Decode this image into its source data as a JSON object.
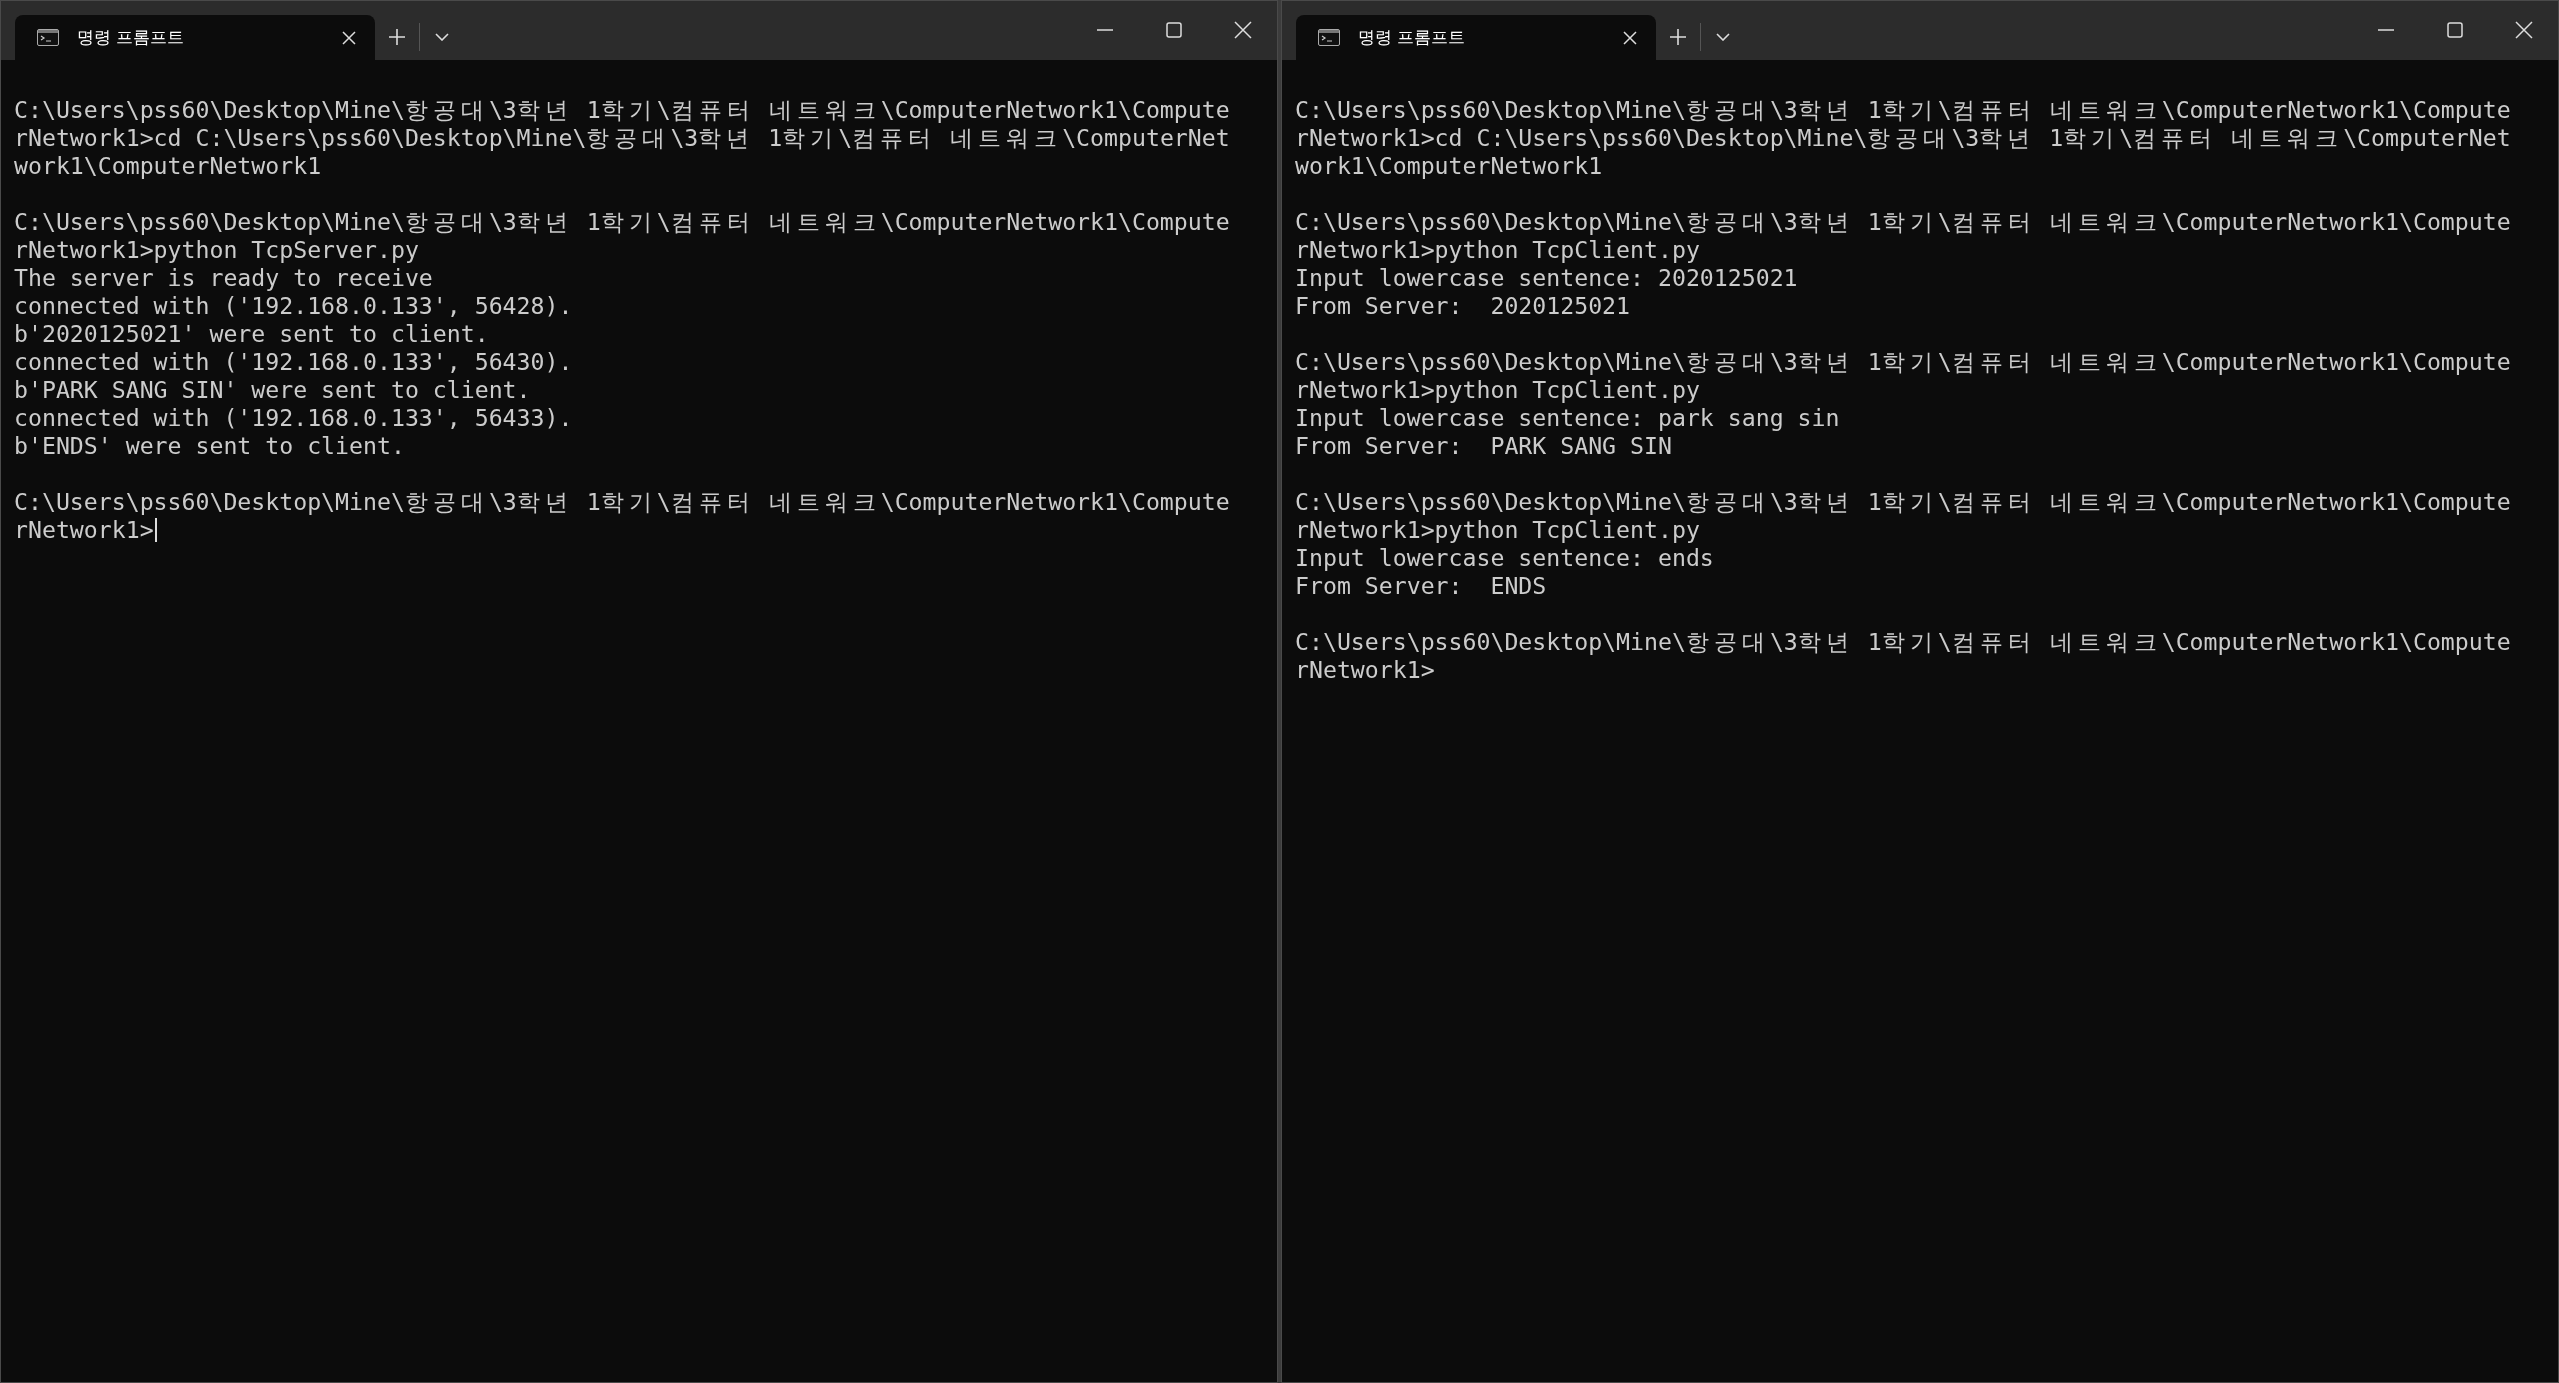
{
  "windows": [
    {
      "tab": {
        "title": "명령 프롬프트",
        "selected": true
      },
      "cursor": true,
      "blocks": [
        [
          "C:\\Users\\pss60\\Desktop\\Mine\\항공대\\3학년 1학기\\컴퓨터 네트워크\\ComputerNetwork1\\Compute",
          "rNetwork1>cd C:\\Users\\pss60\\Desktop\\Mine\\항공대\\3학년 1학기\\컴퓨터 네트워크\\ComputerNet",
          "work1\\ComputerNetwork1"
        ],
        [
          "C:\\Users\\pss60\\Desktop\\Mine\\항공대\\3학년 1학기\\컴퓨터 네트워크\\ComputerNetwork1\\Compute",
          "rNetwork1>python TcpServer.py",
          "The server is ready to receive",
          "connected with ('192.168.0.133', 56428).",
          "b'2020125021' were sent to client.",
          "connected with ('192.168.0.133', 56430).",
          "b'PARK SANG SIN' were sent to client.",
          "connected with ('192.168.0.133', 56433).",
          "b'ENDS' were sent to client."
        ],
        [
          "C:\\Users\\pss60\\Desktop\\Mine\\항공대\\3학년 1학기\\컴퓨터 네트워크\\ComputerNetwork1\\Compute",
          "rNetwork1>"
        ]
      ]
    },
    {
      "tab": {
        "title": "명령 프롬프트",
        "selected": true
      },
      "cursor": false,
      "blocks": [
        [
          "C:\\Users\\pss60\\Desktop\\Mine\\항공대\\3학년 1학기\\컴퓨터 네트워크\\ComputerNetwork1\\Compute",
          "rNetwork1>cd C:\\Users\\pss60\\Desktop\\Mine\\항공대\\3학년 1학기\\컴퓨터 네트워크\\ComputerNet",
          "work1\\ComputerNetwork1"
        ],
        [
          "C:\\Users\\pss60\\Desktop\\Mine\\항공대\\3학년 1학기\\컴퓨터 네트워크\\ComputerNetwork1\\Compute",
          "rNetwork1>python TcpClient.py",
          "Input lowercase sentence: 2020125021",
          "From Server:  2020125021"
        ],
        [
          "C:\\Users\\pss60\\Desktop\\Mine\\항공대\\3학년 1학기\\컴퓨터 네트워크\\ComputerNetwork1\\Compute",
          "rNetwork1>python TcpClient.py",
          "Input lowercase sentence: park sang sin",
          "From Server:  PARK SANG SIN"
        ],
        [
          "C:\\Users\\pss60\\Desktop\\Mine\\항공대\\3학년 1학기\\컴퓨터 네트워크\\ComputerNetwork1\\Compute",
          "rNetwork1>python TcpClient.py",
          "Input lowercase sentence: ends",
          "From Server:  ENDS"
        ],
        [
          "C:\\Users\\pss60\\Desktop\\Mine\\항공대\\3학년 1학기\\컴퓨터 네트워크\\ComputerNetwork1\\Compute",
          "rNetwork1>"
        ]
      ]
    }
  ]
}
